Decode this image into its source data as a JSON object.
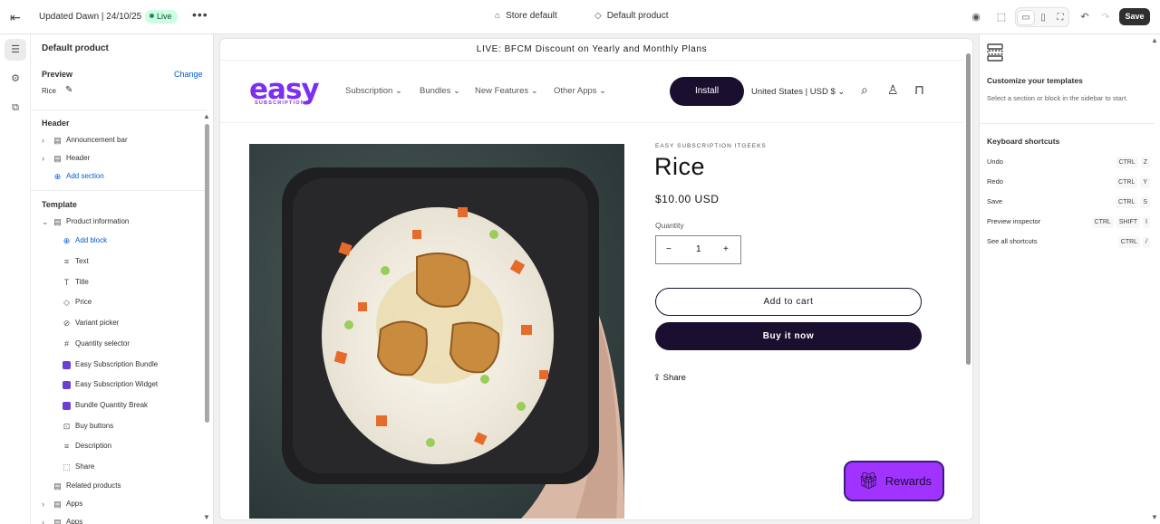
{
  "topbar": {
    "theme_title": "Updated Dawn | 24/10/25",
    "status_badge": "Live",
    "store_select": "Store default",
    "template_select": "Default product",
    "save_label": "Save"
  },
  "sidebar": {
    "title": "Default product",
    "preview_label": "Preview",
    "preview_change": "Change",
    "preview_value": "Rice",
    "header_section": "Header",
    "header_items": [
      "Announcement bar",
      "Header"
    ],
    "add_section": "Add section",
    "template_section": "Template",
    "product_information": "Product information",
    "add_block": "Add block",
    "blocks": [
      {
        "label": "Text",
        "icon": "text-icon"
      },
      {
        "label": "Title",
        "icon": "title-icon"
      },
      {
        "label": "Price",
        "icon": "price-tag-icon"
      },
      {
        "label": "Variant picker",
        "icon": "variant-picker-icon"
      },
      {
        "label": "Quantity selector",
        "icon": "hash-icon"
      },
      {
        "label": "Easy Subscription Bundle",
        "icon": "app-block-icon"
      },
      {
        "label": "Easy Subscription Widget",
        "icon": "app-block-icon"
      },
      {
        "label": "Bundle Quantity Break",
        "icon": "app-block-icon"
      },
      {
        "label": "Buy buttons",
        "icon": "buy-buttons-icon"
      },
      {
        "label": "Description",
        "icon": "description-icon"
      },
      {
        "label": "Share",
        "icon": "share-block-icon"
      }
    ],
    "related_products": "Related products",
    "apps_1": "Apps",
    "apps_2": "Apps"
  },
  "store": {
    "announcement": "LIVE: BFCM Discount on Yearly and Monthly Plans",
    "logo_word": "easy",
    "logo_sub": "SUBSCRIPTIONS",
    "nav": [
      "Subscription",
      "Bundles",
      "New Features",
      "Other Apps"
    ],
    "install_label": "Install",
    "currency": "United States | USD $",
    "product": {
      "vendor": "EASY SUBSCRIPTION ITGEEKS",
      "title": "Rice",
      "price": "$10.00 USD",
      "quantity_label": "Quantity",
      "quantity_value": "1",
      "add_to_cart": "Add to cart",
      "buy_now": "Buy it now",
      "share": "Share"
    },
    "rewards_label": "Rewards"
  },
  "right_panel": {
    "heading": "Customize your templates",
    "body": "Select a section or block in the sidebar to start.",
    "shortcuts_heading": "Keyboard shortcuts",
    "shortcuts": [
      {
        "action": "Undo",
        "keys": [
          "CTRL",
          "Z"
        ]
      },
      {
        "action": "Redo",
        "keys": [
          "CTRL",
          "Y"
        ]
      },
      {
        "action": "Save",
        "keys": [
          "CTRL",
          "S"
        ]
      },
      {
        "action": "Preview inspector",
        "keys": [
          "CTRL",
          "SHIFT",
          "I"
        ]
      },
      {
        "action": "See all shortcuts",
        "keys": [
          "CTRL",
          "/"
        ]
      }
    ]
  },
  "colors": {
    "brand_purple": "#7c2ff0",
    "dark_button": "#1a0f2e",
    "rewards": "#a033ff",
    "link_blue": "#005bd3"
  }
}
